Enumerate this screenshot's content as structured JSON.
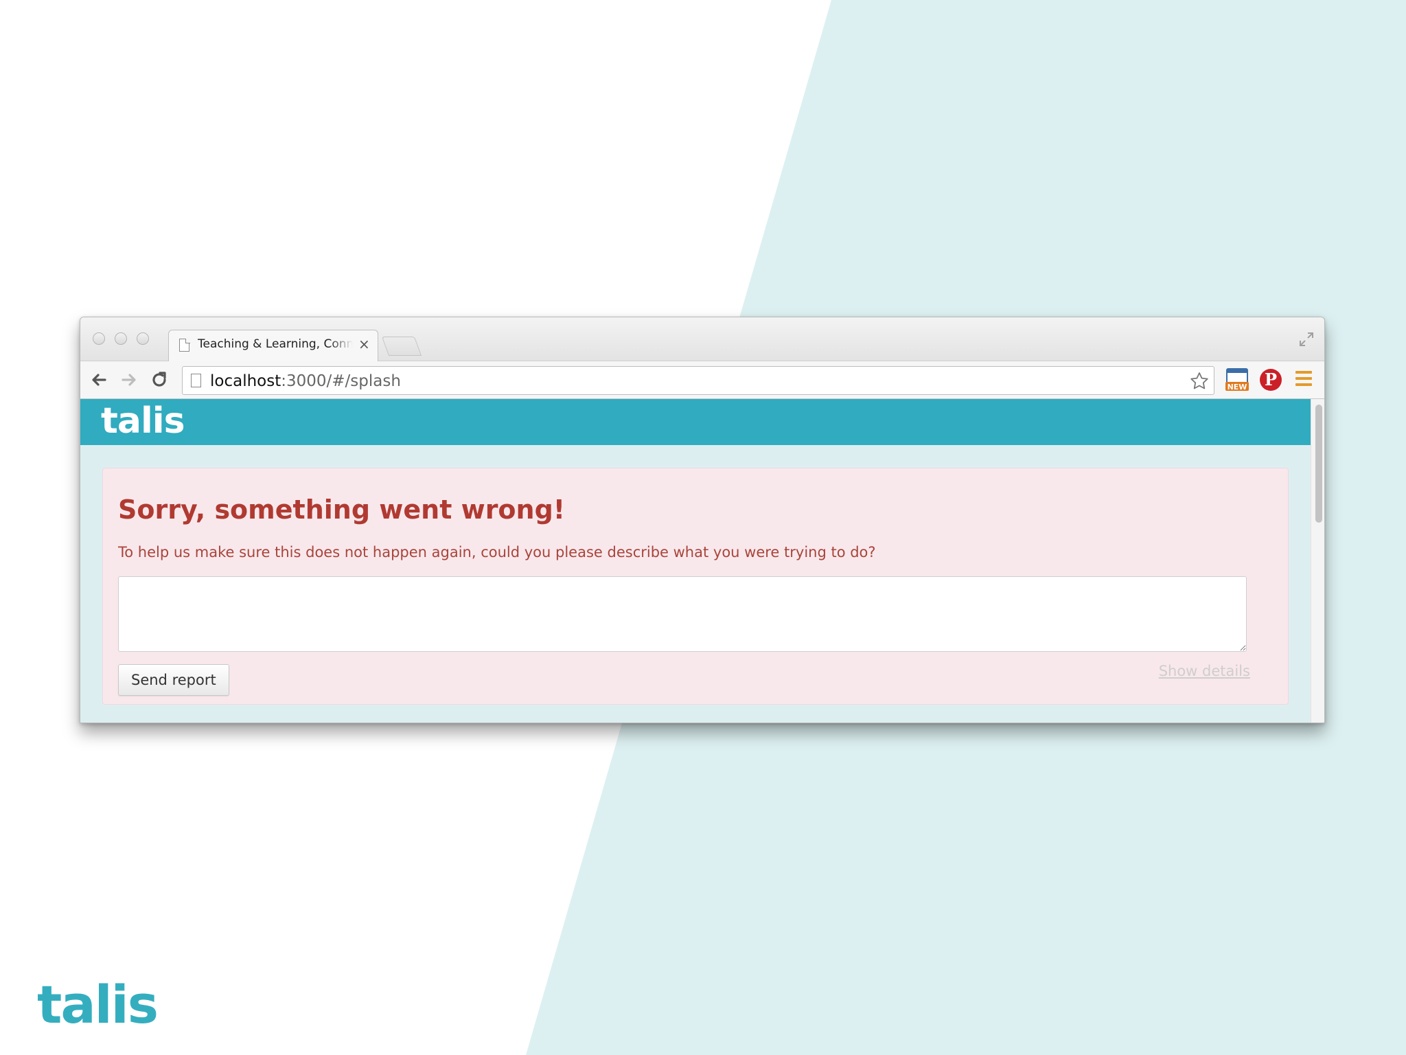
{
  "browser": {
    "tab": {
      "title": "Teaching & Learning, Connected",
      "close_glyph": "×"
    },
    "url": {
      "host": "localhost",
      "rest": ":3000/#/splash"
    },
    "extension": {
      "badge_label": "NEW"
    },
    "pinterest_glyph": "P"
  },
  "app": {
    "logo": "talis"
  },
  "error": {
    "title": "Sorry, something went wrong!",
    "description": "To help us make sure this does not happen again, could you please describe what you were trying to do?",
    "textarea_value": "",
    "send_label": "Send report",
    "details_label": "Show details"
  },
  "brand": {
    "logo": "talis"
  },
  "colors": {
    "app_header": "#31abbf",
    "error_title": "#b03a31",
    "error_panel_bg": "#f8e8ec",
    "pinterest": "#cb2027",
    "menu_icon": "#e39b2a",
    "background_tint": "#ddf0f1"
  }
}
